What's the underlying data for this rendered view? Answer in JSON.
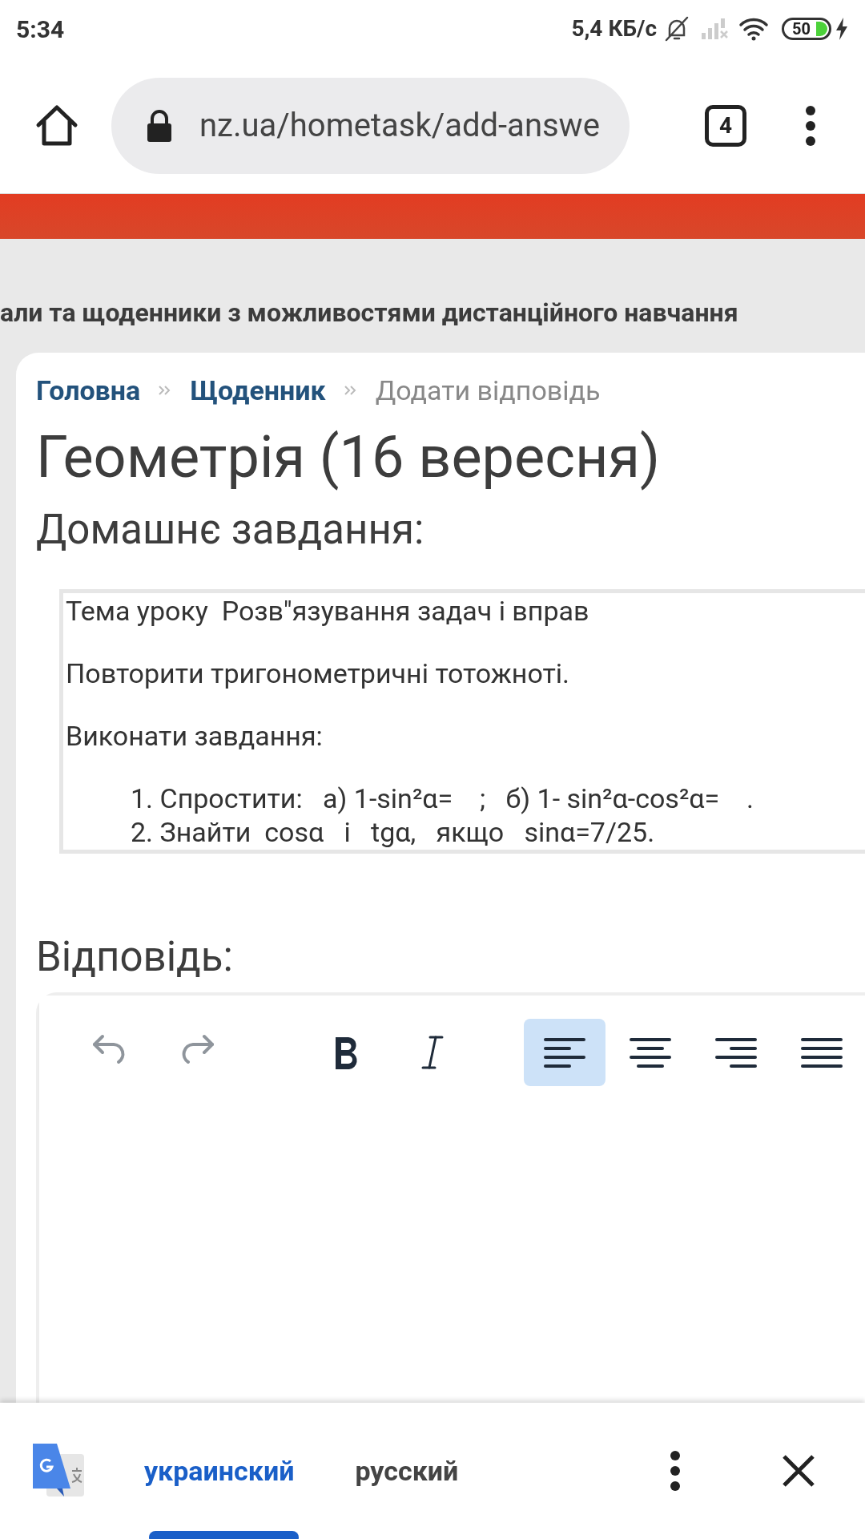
{
  "status_bar": {
    "time": "5:34",
    "speed": "5,4 КБ/с",
    "battery": "50"
  },
  "browser": {
    "url": "nz.ua/hometask/add-answe",
    "tab_count": "4"
  },
  "site": {
    "tagline": "али та щоденники з можливостями дистанційного навчання"
  },
  "breadcrumb": [
    {
      "label": "Головна",
      "kind": "link"
    },
    {
      "label": "Щоденник",
      "kind": "link"
    },
    {
      "label": "Додати відповідь",
      "kind": "current"
    }
  ],
  "title": "Геометрія (16 вересня)",
  "section_heading": "Домашнє завдання:",
  "task": {
    "lines": [
      {
        "kind": "paragraph",
        "text": "Тема уроку  Розв\"язування задач і вправ"
      },
      {
        "kind": "paragraph",
        "text": "Повторити тригонометричні тотожноті."
      },
      {
        "kind": "paragraph",
        "text": "Виконати завдання:"
      },
      {
        "kind": "list_item",
        "text": "1. Спростити:   а) 1-sin²α=    ;   б) 1- sin²α-cos²α=    ."
      },
      {
        "kind": "list_item",
        "text": "2. Знайти  cosα   і   tgα,   якщо   sinα=7/25."
      }
    ]
  },
  "answer_heading": "Відповідь:",
  "editor": {
    "toolbar": [
      {
        "kind": "undo",
        "disabled": true,
        "selected": false
      },
      {
        "kind": "redo",
        "disabled": true,
        "selected": false
      },
      {
        "kind": "bold",
        "disabled": false,
        "selected": false
      },
      {
        "kind": "italic",
        "disabled": false,
        "selected": false
      },
      {
        "kind": "align_left",
        "disabled": false,
        "selected": true
      },
      {
        "kind": "align_center",
        "disabled": false,
        "selected": false
      },
      {
        "kind": "align_right",
        "disabled": false,
        "selected": false
      },
      {
        "kind": "align_justify",
        "disabled": false,
        "selected": false
      }
    ]
  },
  "translate": {
    "languages": [
      {
        "label": "украинский",
        "selected": true
      },
      {
        "label": "русский",
        "selected": false
      }
    ]
  }
}
